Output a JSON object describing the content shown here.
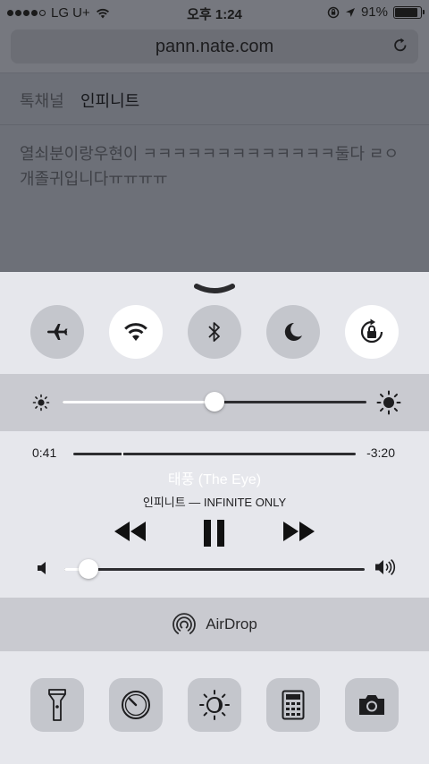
{
  "status_bar": {
    "carrier": "LG U+",
    "time": "오후 1:24",
    "battery": "91%",
    "battery_level": 0.91,
    "signal_bars": 4,
    "signal_total": 5
  },
  "browser": {
    "url": "pann.nate.com"
  },
  "page": {
    "tabs": [
      "톡채널",
      "인피니트"
    ],
    "post_text": "열쇠분이랑우현이 ㅋㅋㅋㅋㅋㅋㅋㅋㅋㅋㅋㅋㅋ둘다 ㄹㅇ개졸귀입니다ㅠㅠㅠㅠ"
  },
  "control_center": {
    "toggles": [
      {
        "name": "airplane-mode",
        "icon": "airplane-icon",
        "on": false
      },
      {
        "name": "wifi",
        "icon": "wifi-icon",
        "on": true
      },
      {
        "name": "bluetooth",
        "icon": "bluetooth-icon",
        "on": false
      },
      {
        "name": "do-not-disturb",
        "icon": "moon-icon",
        "on": false
      },
      {
        "name": "rotation-lock",
        "icon": "rotation-lock-icon",
        "on": true
      }
    ],
    "brightness_level": 0.5,
    "music": {
      "elapsed": "0:41",
      "remaining": "-3:20",
      "progress": 0.17,
      "title": "태풍 (The Eye)",
      "artist_album": "인피니트 — INFINITE ONLY",
      "volume_level": 0.08
    },
    "airdrop_label": "AirDrop",
    "tools": [
      {
        "name": "flashlight",
        "icon": "flashlight-icon"
      },
      {
        "name": "timer",
        "icon": "timer-icon"
      },
      {
        "name": "night-shift",
        "icon": "night-shift-icon"
      },
      {
        "name": "calculator",
        "icon": "calculator-icon"
      },
      {
        "name": "camera",
        "icon": "camera-icon"
      }
    ]
  },
  "colors": {
    "cc_background": "#e6e7ec",
    "toggle_off": "#c4c6cc",
    "toggle_on": "#ffffff",
    "band": "#c9cad0",
    "dimmed_page": "#6d7078"
  }
}
